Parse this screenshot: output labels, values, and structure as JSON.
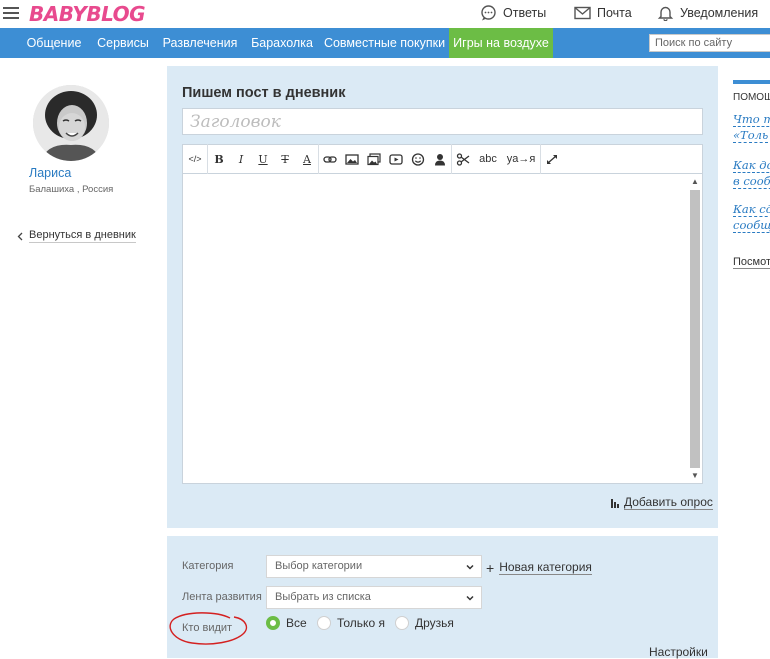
{
  "header": {
    "logo": "BABYBLOG",
    "nav": [
      {
        "label": "Ответы",
        "icon": "chat-icon"
      },
      {
        "label": "Почта",
        "icon": "mail-icon"
      },
      {
        "label": "Уведомления",
        "icon": "bell-icon"
      }
    ]
  },
  "main_nav": {
    "items": [
      {
        "label": "Общение"
      },
      {
        "label": "Сервисы"
      },
      {
        "label": "Развлечения"
      },
      {
        "label": "Барахолка"
      },
      {
        "label": "Совместные покупки"
      },
      {
        "label": "Игры на воздухе",
        "active": true
      }
    ],
    "search_placeholder": "Поиск по сайту",
    "accent_color": "#3d8ed4",
    "active_color": "#6cbd45"
  },
  "profile": {
    "name": "Лариса",
    "location": "Балашиха , Россия",
    "back_link": "Вернуться в дневник"
  },
  "editor": {
    "heading": "Пишем пост в дневник",
    "title_placeholder": "Заголовок",
    "toolbar": {
      "source": "</>",
      "bold": "B",
      "italic": "I",
      "underline": "U",
      "strike": "T",
      "color": "A",
      "spellcheck": "abc",
      "translit": "ya→я"
    },
    "add_poll": "Добавить опрос"
  },
  "form": {
    "category_label": "Категория",
    "category_placeholder": "Выбор категории",
    "new_category": "Новая категория",
    "feed_label": "Лента развития",
    "feed_placeholder": "Выбрать из списка",
    "visibility_label": "Кто видит",
    "visibility_options": [
      {
        "label": "Все",
        "selected": true
      },
      {
        "label": "Только я",
        "selected": false
      },
      {
        "label": "Друзья",
        "selected": false
      }
    ],
    "settings": "Настройки"
  },
  "right_sidebar": {
    "help_title": "ПОМОЩЬ",
    "links": [
      {
        "line1": "Что т",
        "line2": "«Толь"
      },
      {
        "line1": "Как до",
        "line2": "в сообщ"
      },
      {
        "line1": "Как сд",
        "line2": "сообще"
      }
    ],
    "more": "Посмотр"
  }
}
